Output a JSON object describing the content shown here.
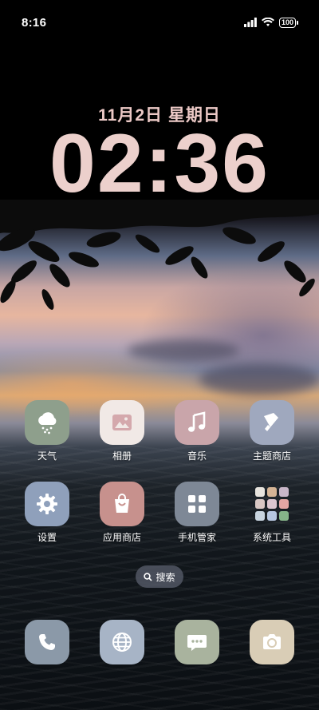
{
  "status_bar": {
    "time": "8:16",
    "battery": "100",
    "icons": [
      "signal-icon",
      "wifi-icon",
      "battery-icon"
    ]
  },
  "lockscreen": {
    "date": "11月2日 星期日",
    "clock": "02:36"
  },
  "apps_row1": [
    {
      "label": "天气",
      "icon": "weather-icon",
      "color": "#8e9f8c"
    },
    {
      "label": "相册",
      "icon": "gallery-icon",
      "color": "#f1e9e6"
    },
    {
      "label": "音乐",
      "icon": "music-icon",
      "color": "#c9a5aa"
    },
    {
      "label": "主题商店",
      "icon": "theme-brush-icon",
      "color": "#9fa8be"
    }
  ],
  "apps_row2": [
    {
      "label": "设置",
      "icon": "gear-icon",
      "color": "#8fa0bb"
    },
    {
      "label": "应用商店",
      "icon": "shopping-bag-icon",
      "color": "#c7918d"
    },
    {
      "label": "手机管家",
      "icon": "grid-icon",
      "color": "#7e8896"
    },
    {
      "label": "系统工具",
      "icon": "folder-icon",
      "color": "transparent"
    }
  ],
  "search": {
    "label": "搜索"
  },
  "dock": [
    {
      "icon": "phone-icon",
      "color": "#8b99a8"
    },
    {
      "icon": "browser-icon",
      "color": "#a7b4c6"
    },
    {
      "icon": "messages-icon",
      "color": "#a9b39e"
    },
    {
      "icon": "camera-icon",
      "color": "#d9cdb6"
    }
  ]
}
